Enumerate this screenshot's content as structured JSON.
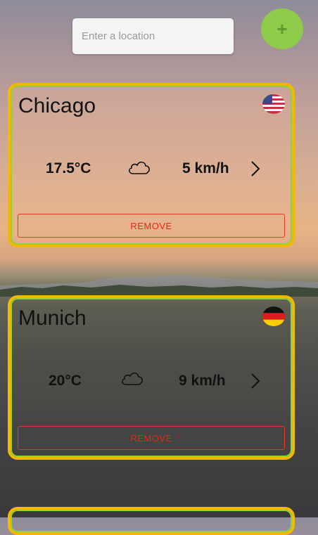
{
  "search": {
    "placeholder": "Enter a location"
  },
  "add_button": {
    "label": "+"
  },
  "cards": [
    {
      "city": "Chicago",
      "flag": "us-flag-icon",
      "temperature": "17.5°C",
      "weather_icon": "cloud-icon",
      "wind": "5 km/h",
      "remove_label": "REMOVE"
    },
    {
      "city": "Munich",
      "flag": "de-flag-icon",
      "temperature": "20°C",
      "weather_icon": "cloud-icon",
      "wind": "9 km/h",
      "remove_label": "REMOVE"
    }
  ],
  "colors": {
    "accent_border": "#f5b800",
    "inner_border": "#8fd23b",
    "remove": "#e8241a",
    "add_button": "#8ecb4a"
  }
}
